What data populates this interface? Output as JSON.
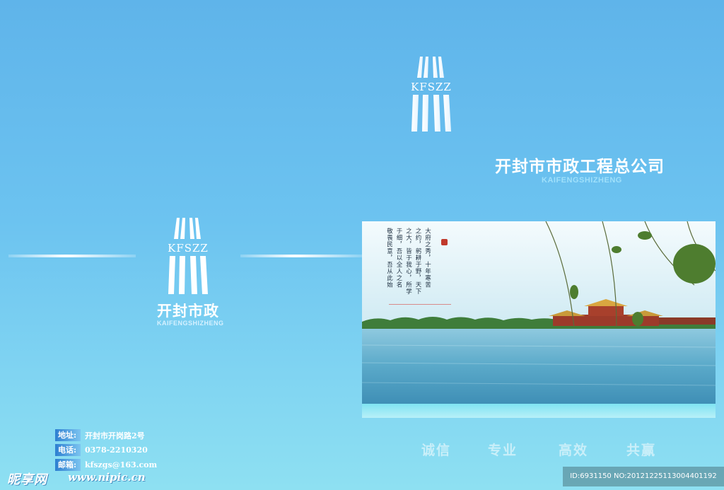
{
  "logo": {
    "monogram": "KFSZZ"
  },
  "brand_small": {
    "name_cn": "开封市政",
    "name_en": "KAIFENGSHIZHENG"
  },
  "company": {
    "name_cn": "开封市市政工程总公司",
    "name_en": "KAIFENGSHIZHENG"
  },
  "poem": {
    "columns": [
      "大府之秀，十年寒苦",
      "之约，躬耕于野，天下",
      "之大，皆于我心，所学",
      "于细，吾以全人之名",
      "敬畏民意，吾从此始"
    ]
  },
  "contact": {
    "rows": [
      {
        "label": "地址:",
        "value": "开封市开岗路2号"
      },
      {
        "label": "电话:",
        "value": "0378-2210320"
      },
      {
        "label": "邮箱:",
        "value": "kfszgs@163.com"
      }
    ]
  },
  "slogans": [
    "诚信",
    "专业",
    "高效",
    "共赢"
  ],
  "watermark": {
    "site_logo": "昵享网",
    "url": "www.nipic.cn",
    "id_text": "ID:6931150 NO:20121225113004401192"
  },
  "colors": {
    "background_top": "#5fb4ea",
    "background_bottom": "#8ee0f2",
    "text": "#ffffff",
    "accent_light": "#9fe0fb",
    "seal": "#c0392b"
  }
}
